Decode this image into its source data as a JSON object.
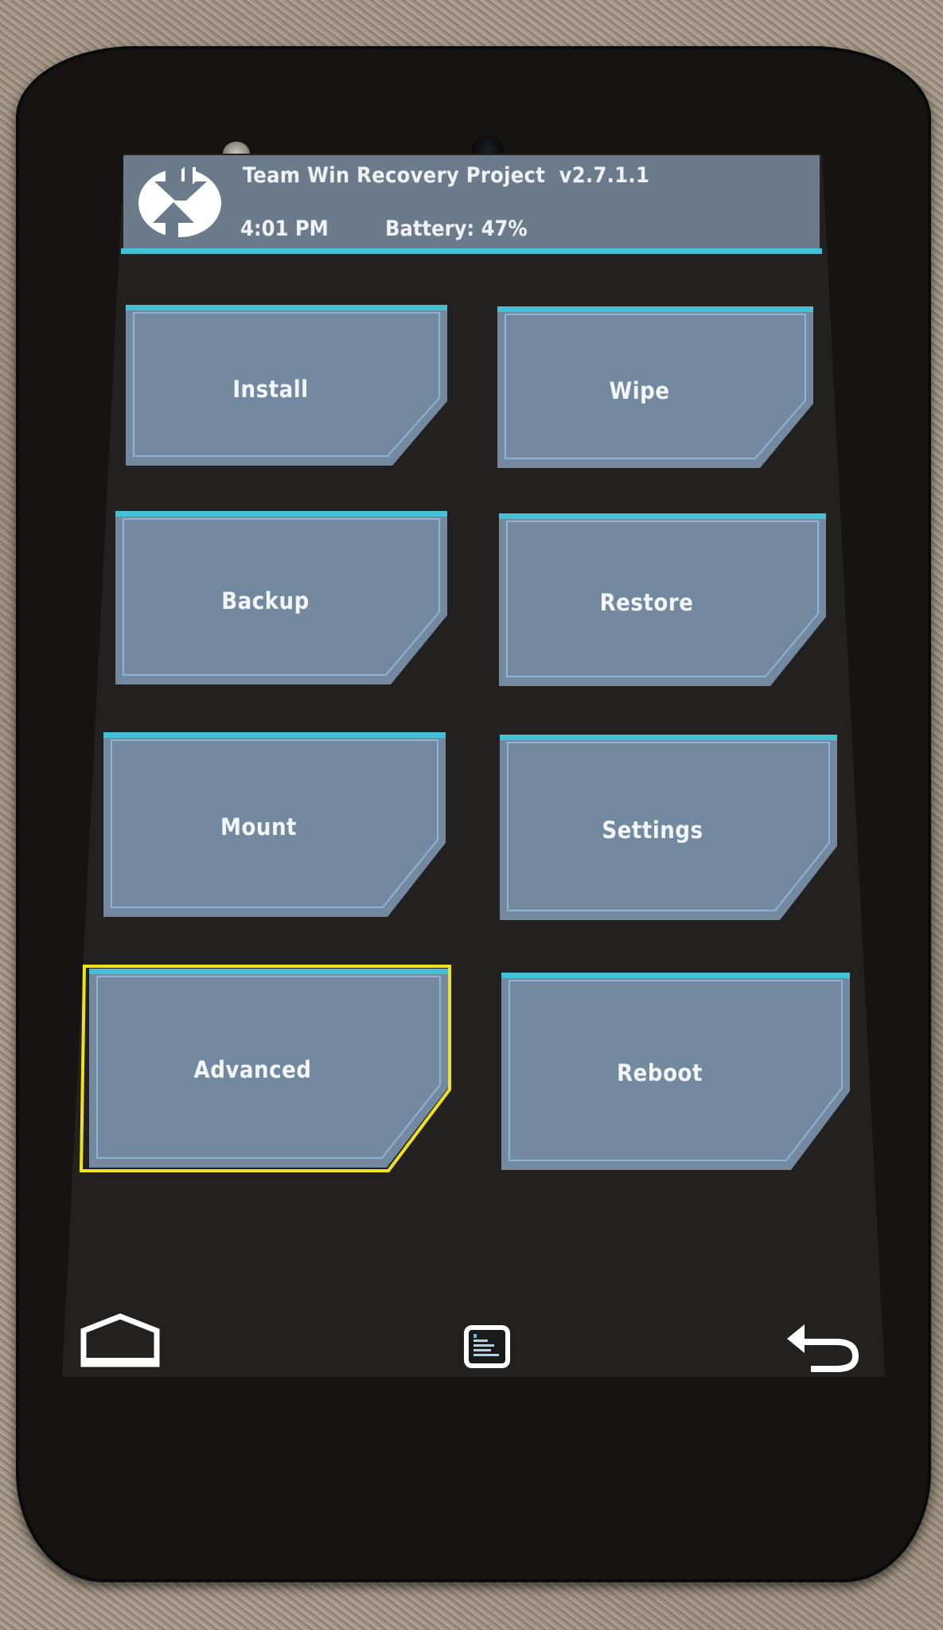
{
  "app": {
    "title": "Team Win Recovery Project  v2.7.1.1",
    "time": "4:01 PM",
    "battery": "Battery: 47%",
    "logo_icon": "twrp-logo-icon"
  },
  "colors": {
    "header_bg": "#6c7b8b",
    "accent_cyan": "#45c1d6",
    "button_face": "#7289a0",
    "button_edge": "#8fb3d4",
    "focus_highlight": "#f2e21b",
    "screen_bg": "#222120"
  },
  "menu": {
    "buttons": [
      {
        "id": "install",
        "label": "Install",
        "focused": false
      },
      {
        "id": "wipe",
        "label": "Wipe",
        "focused": false
      },
      {
        "id": "backup",
        "label": "Backup",
        "focused": false
      },
      {
        "id": "restore",
        "label": "Restore",
        "focused": false
      },
      {
        "id": "mount",
        "label": "Mount",
        "focused": false
      },
      {
        "id": "settings",
        "label": "Settings",
        "focused": false
      },
      {
        "id": "advanced",
        "label": "Advanced",
        "focused": true
      },
      {
        "id": "reboot",
        "label": "Reboot",
        "focused": false
      }
    ]
  },
  "navbar": {
    "home_icon": "home-icon",
    "console_icon": "console-log-icon",
    "back_icon": "back-arrow-icon"
  }
}
